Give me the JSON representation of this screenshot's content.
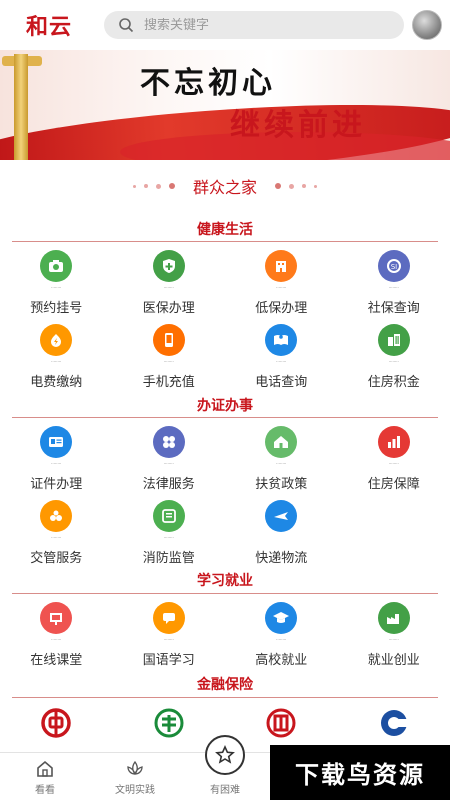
{
  "header": {
    "logo": "和云",
    "search_placeholder": "搜索关键字"
  },
  "banner": {
    "line1": "不忘初心",
    "line2": "继续前进"
  },
  "home_title": "群众之家",
  "sections": [
    {
      "title": "健康生活",
      "items": [
        {
          "label": "预约挂号",
          "icon": "camera-icon",
          "color": "#4caf50"
        },
        {
          "label": "医保办理",
          "icon": "medical-shield-icon",
          "color": "#43a047"
        },
        {
          "label": "低保办理",
          "icon": "building-icon",
          "color": "#ff7a1a"
        },
        {
          "label": "社保查询",
          "icon": "social-security-icon",
          "color": "#5c6bc0"
        },
        {
          "label": "电费缴纳",
          "icon": "electric-bolt-icon",
          "color": "#ff9800"
        },
        {
          "label": "手机充值",
          "icon": "phone-icon",
          "color": "#ff6f00"
        },
        {
          "label": "电话查询",
          "icon": "book-icon",
          "color": "#1e88e5"
        },
        {
          "label": "住房积金",
          "icon": "buildings-icon",
          "color": "#43a047"
        }
      ]
    },
    {
      "title": "办证办事",
      "items": [
        {
          "label": "证件办理",
          "icon": "id-card-icon",
          "color": "#1e88e5"
        },
        {
          "label": "法律服务",
          "icon": "clover-icon",
          "color": "#5c6bc0"
        },
        {
          "label": "扶贫政策",
          "icon": "house-icon",
          "color": "#66bb6a"
        },
        {
          "label": "住房保障",
          "icon": "bar-chart-icon",
          "color": "#e53935"
        },
        {
          "label": "交管服务",
          "icon": "traffic-icon",
          "color": "#ff9800"
        },
        {
          "label": "消防监管",
          "icon": "fire-icon",
          "color": "#4caf50"
        },
        {
          "label": "快递物流",
          "icon": "airplane-icon",
          "color": "#1e88e5"
        }
      ]
    },
    {
      "title": "学习就业",
      "items": [
        {
          "label": "在线课堂",
          "icon": "classroom-icon",
          "color": "#ef5350"
        },
        {
          "label": "国语学习",
          "icon": "chat-icon",
          "color": "#ff9800"
        },
        {
          "label": "高校就业",
          "icon": "graduation-cap-icon",
          "color": "#1e88e5"
        },
        {
          "label": "就业创业",
          "icon": "factory-icon",
          "color": "#43a047"
        }
      ]
    },
    {
      "title": "金融保险",
      "items": [
        {
          "label": "",
          "icon": "bank-of-china-icon",
          "color": "#c8161d"
        },
        {
          "label": "",
          "icon": "abc-bank-icon",
          "color": "#1a8b3a"
        },
        {
          "label": "",
          "icon": "icbc-bank-icon",
          "color": "#c8161d"
        },
        {
          "label": "",
          "icon": "ccb-bank-icon",
          "color": "#1c4fa1"
        }
      ]
    }
  ],
  "bottom_nav": [
    {
      "label": "看看",
      "icon": "home-icon"
    },
    {
      "label": "文明实践",
      "icon": "lotus-icon"
    },
    {
      "label": "有困难",
      "icon": "star-icon"
    }
  ],
  "watermark": "下载鸟资源"
}
